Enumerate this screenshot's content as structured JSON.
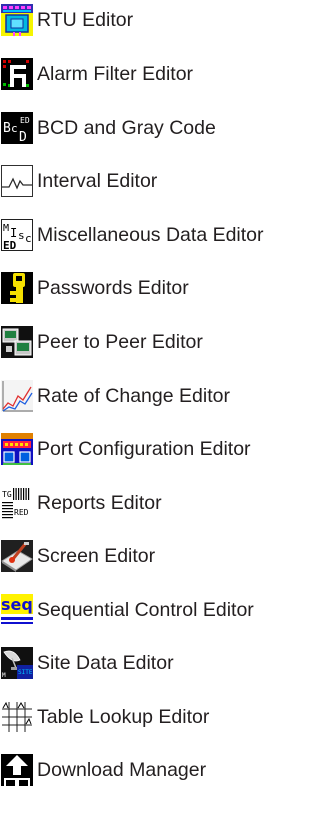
{
  "tools": [
    {
      "label": "RTU Editor",
      "icon": "rtu-editor-icon"
    },
    {
      "label": "Alarm Filter Editor",
      "icon": "alarm-filter-icon"
    },
    {
      "label": "BCD and Gray Code",
      "icon": "bcd-gray-code-icon"
    },
    {
      "label": "Interval Editor",
      "icon": "interval-waveform-icon"
    },
    {
      "label": "Miscellaneous Data Editor",
      "icon": "misc-data-icon"
    },
    {
      "label": "Passwords Editor",
      "icon": "key-icon"
    },
    {
      "label": "Peer to Peer Editor",
      "icon": "peer-to-peer-icon"
    },
    {
      "label": "Rate of Change Editor",
      "icon": "rate-of-change-chart-icon"
    },
    {
      "label": "Port Configuration Editor",
      "icon": "port-configuration-icon"
    },
    {
      "label": "Reports Editor",
      "icon": "reports-icon"
    },
    {
      "label": "Screen Editor",
      "icon": "screen-editor-icon"
    },
    {
      "label": "Sequential Control Editor",
      "icon": "sequential-control-icon"
    },
    {
      "label": "Site Data Editor",
      "icon": "site-data-satellite-icon"
    },
    {
      "label": "Table Lookup Editor",
      "icon": "table-lookup-grid-icon"
    },
    {
      "label": "Download Manager",
      "icon": "download-arrow-icon"
    }
  ]
}
